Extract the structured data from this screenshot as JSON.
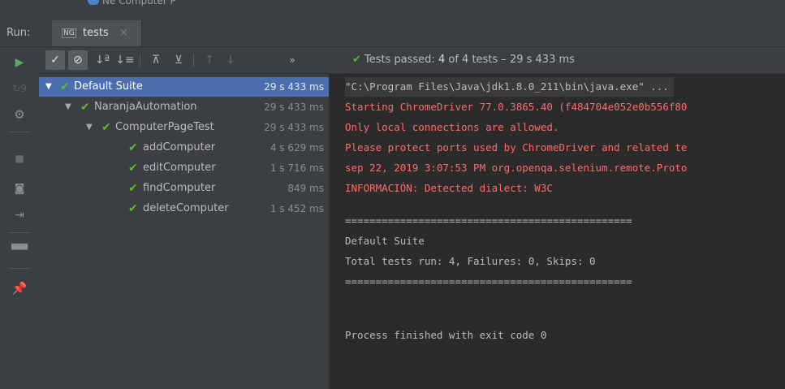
{
  "top_strip": {
    "partial_text": "Ne Computer P"
  },
  "run_bar": {
    "label": "Run:",
    "tab": {
      "icon_text": "NG",
      "name": "tests",
      "close": "×"
    }
  },
  "toolbar": {
    "status": {
      "prefix": "Tests passed:",
      "count": "4",
      "rest": "of 4 tests – 29 s 433 ms"
    },
    "more": "»"
  },
  "tree": {
    "rows": [
      {
        "label": "Default Suite",
        "time": "29 s 433 ms"
      },
      {
        "label": "NaranjaAutomation",
        "time": "29 s 433 ms"
      },
      {
        "label": "ComputerPageTest",
        "time": "29 s 433 ms"
      },
      {
        "label": "addComputer",
        "time": "4 s 629 ms"
      },
      {
        "label": "editComputer",
        "time": "1 s 716 ms"
      },
      {
        "label": "findComputer",
        "time": "849 ms"
      },
      {
        "label": "deleteComputer",
        "time": "1 s 452 ms"
      }
    ]
  },
  "console": {
    "lines": [
      "\"C:\\Program Files\\Java\\jdk1.8.0_211\\bin\\java.exe\" ...",
      "Starting ChromeDriver 77.0.3865.40 (f484704e052e0b556f80",
      "Only local connections are allowed.",
      "Please protect ports used by ChromeDriver and related te",
      "sep 22, 2019 3:07:53 PM org.openqa.selenium.remote.Proto",
      "INFORMACIÓN: Detected dialect: W3C",
      "===============================================",
      "Default Suite",
      "Total tests run: 4, Failures: 0, Skips: 0",
      "===============================================",
      "Process finished with exit code 0"
    ]
  },
  "colors": {
    "pass": "#5fb832",
    "error": "#ff6b68",
    "selection": "#4b6eaf",
    "panel": "#3c3f41",
    "console_bg": "#2b2b2b"
  },
  "icons": [
    "play-icon",
    "rerun-failed-icon",
    "debug-icon",
    "stop-icon",
    "camera-icon",
    "exit-icon",
    "layout-icon",
    "pin-icon",
    "show-passed-icon",
    "show-ignored-icon",
    "sort-alpha-icon",
    "sort-duration-icon",
    "expand-all-icon",
    "collapse-all-icon",
    "prev-failed-icon",
    "next-failed-icon"
  ]
}
